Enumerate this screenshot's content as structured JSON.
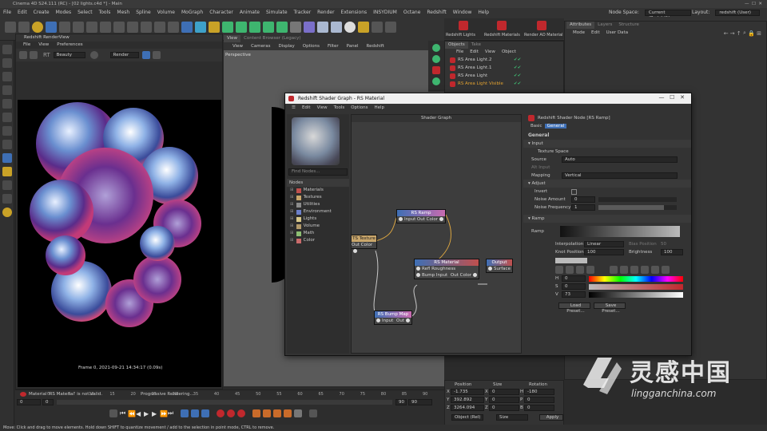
{
  "window": {
    "title": "Cinema 4D S24.111 (RC) - [02 lights.c4d *] - Main"
  },
  "menubar": {
    "items": [
      "File",
      "Edit",
      "Create",
      "Modes",
      "Select",
      "Tools",
      "Mesh",
      "Spline",
      "Volume",
      "MoGraph",
      "Character",
      "Animate",
      "Simulate",
      "Tracker",
      "Render",
      "Extensions",
      "INSYDIUM",
      "Octane",
      "Redshift",
      "Window",
      "Help"
    ],
    "node_space_label": "Node Space:",
    "node_space_value": "Current (Redshift)",
    "layout_label": "Layout:",
    "layout_value": "redshift (User)"
  },
  "redshift_toolbar": {
    "lights": "Redshift Lights",
    "materials": "Redshift Materials",
    "ao": "Render AO Material"
  },
  "renderview": {
    "title": "Redshift RenderView",
    "menu": [
      "File",
      "View",
      "Preferences"
    ],
    "mode_value": "Beauty",
    "render_value": "Render",
    "frame_info": "Frame 0,  2021-09-21  14:34:17  (0.09s)"
  },
  "viewport": {
    "menu": [
      "View",
      "Cameras",
      "Display",
      "Options",
      "Filter",
      "Panel",
      "Redshift"
    ],
    "label": "Perspective",
    "tabs": [
      "View",
      "Content Browser (Legacy)"
    ]
  },
  "objects": {
    "tabs": [
      "Objects",
      "Take"
    ],
    "menu": [
      "File",
      "Edit",
      "View",
      "Object"
    ],
    "items": [
      "RS Area Light.2",
      "RS Area Light.1",
      "RS Area Light",
      "RS Area Light Visible"
    ]
  },
  "attributes": {
    "tabs": [
      "Attributes",
      "Layers",
      "Structure"
    ],
    "menu": [
      "Mode",
      "Edit",
      "User Data"
    ]
  },
  "shader_graph": {
    "window_title": "Redshift Shader Graph - RS Material",
    "menu": [
      "Edit",
      "View",
      "Tools",
      "Options",
      "Help"
    ],
    "canvas_title": "Shader Graph",
    "find_placeholder": "Find Nodes...",
    "nodes_header": "Nodes",
    "categories": [
      {
        "label": "Materials",
        "color": "#c0504d"
      },
      {
        "label": "Textures",
        "color": "#c9a66b"
      },
      {
        "label": "Utilities",
        "color": "#8c8c8c"
      },
      {
        "label": "Environment",
        "color": "#6b7fc9"
      },
      {
        "label": "Lights",
        "color": "#d8c88a"
      },
      {
        "label": "Volume",
        "color": "#b39a6b"
      },
      {
        "label": "Math",
        "color": "#8dbf73"
      },
      {
        "label": "Color",
        "color": "#c96b6b"
      }
    ],
    "node_ramp": {
      "title": "RS Ramp",
      "in": "Input",
      "out": "Out Color"
    },
    "node_texture": {
      "title": "TS Texture",
      "out": "Out Color"
    },
    "node_material": {
      "title": "RS Material",
      "in1": "Refl Roughness",
      "in2": "Bump Input",
      "out": "Out Color"
    },
    "node_output": {
      "title": "Output",
      "in": "Surface"
    },
    "node_bump": {
      "title": "RS Bump Map",
      "in": "Input",
      "out": "Out"
    },
    "attr": {
      "node_title": "Redshift Shader Node [RS Ramp]",
      "tabs": [
        "Basic",
        "General"
      ],
      "general": "General",
      "input": "Input",
      "texture_space": "Texture Space",
      "source_label": "Source",
      "source_value": "Auto",
      "alt_input": "Alt Input",
      "mapping_label": "Mapping",
      "mapping_value": "Vertical",
      "adjust": "Adjust",
      "invert": "Invert",
      "noise_amount_label": "Noise Amount",
      "noise_amount_value": "0",
      "noise_freq_label": "Noise Frequency",
      "noise_freq_value": "1",
      "ramp_section": "Ramp",
      "ramp_label": "Ramp",
      "interp_label": "Interpolation",
      "interp_value": "Linear",
      "knot_pos_label": "Knot Position",
      "knot_pos_value": "100",
      "bias_label": "Bias Position",
      "bias_value": "50",
      "brightness_label": "Brightness",
      "brightness_value": "100",
      "h_label": "H",
      "h_value": "0",
      "s_label": "S",
      "s_value": "0",
      "v_label": "V",
      "v_value": "73",
      "load_preset": "Load Preset...",
      "save_preset": "Save Preset..."
    }
  },
  "coords": {
    "position": "Position",
    "size": "Size",
    "rotation": "Rotation",
    "x_label": "X",
    "x_pos": "-1.735",
    "x_size": "0",
    "h_label": "H",
    "h_rot": "-180",
    "y_label": "Y",
    "y_pos": "392.892",
    "y_size": "0",
    "p_label": "P",
    "p_rot": "0",
    "z_label": "Z",
    "z_pos": "3264.094",
    "z_size": "0",
    "b_label": "B",
    "b_rot": "0",
    "object_mode": "Object (Rel)",
    "size_mode": "Size",
    "apply": "Apply"
  },
  "timeline": {
    "ticks": [
      "0",
      "5",
      "10",
      "15",
      "20",
      "25",
      "30",
      "35",
      "40",
      "45",
      "50",
      "55",
      "60",
      "65",
      "70",
      "75",
      "80",
      "85",
      "90"
    ],
    "warning": "Material 'RS Material' is not valid.",
    "progress": "Progressive Rendering...",
    "start_frame": "0",
    "current_frame": "0",
    "end_frame": "90",
    "end_frame2": "90"
  },
  "statusbar": {
    "text": "Move: Click and drag to move elements. Hold down SHIFT to quantize movement / add to the selection in point mode, CTRL to remove."
  },
  "watermark": {
    "brand": "灵感中国",
    "url": "lingganchina.com"
  }
}
